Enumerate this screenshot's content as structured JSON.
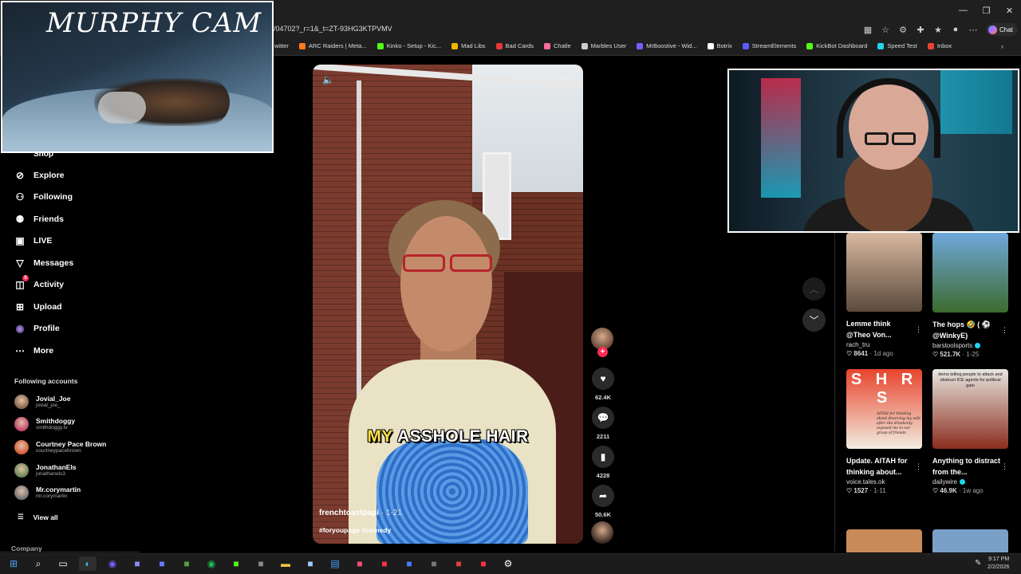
{
  "browser": {
    "url": "/04702?_r=1&_t=ZT-93HG3KTPVMV",
    "chat_label": "Chat",
    "window_controls": [
      "—",
      "❐",
      "✕"
    ],
    "bookmarks": [
      {
        "label": "witter",
        "color": "#1da1f2"
      },
      {
        "label": "ARC Raiders | Meta...",
        "color": "#ff7a1a"
      },
      {
        "label": "Kinko - Setup - Kic...",
        "color": "#53fc18"
      },
      {
        "label": "Mad Libs",
        "color": "#f5b400"
      },
      {
        "label": "Bad Cards",
        "color": "#e53935"
      },
      {
        "label": "Chatle",
        "color": "#ff6b9a"
      },
      {
        "label": "Marbles User",
        "color": "#cccccc"
      },
      {
        "label": "MrBoostive - Wid...",
        "color": "#7b5cff"
      },
      {
        "label": "Botrix",
        "color": "#ffffff"
      },
      {
        "label": "StreamElements",
        "color": "#5b5bff"
      },
      {
        "label": "KickBot Dashboard",
        "color": "#53fc18"
      },
      {
        "label": "Speed Test",
        "color": "#20d5ec"
      },
      {
        "label": "Inbox",
        "color": "#ea4335"
      }
    ]
  },
  "overlays": {
    "murphy_cam_title": "MURPHY CAM"
  },
  "sidebar": {
    "shop_label": "Shop",
    "items": [
      {
        "label": "Explore",
        "icon": "compass-icon"
      },
      {
        "label": "Following",
        "icon": "user-plus-icon"
      },
      {
        "label": "Friends",
        "icon": "friends-icon"
      },
      {
        "label": "LIVE",
        "icon": "live-icon"
      },
      {
        "label": "Messages",
        "icon": "messages-icon"
      },
      {
        "label": "Activity",
        "icon": "activity-icon",
        "badge": "5"
      },
      {
        "label": "Upload",
        "icon": "upload-icon"
      },
      {
        "label": "Profile",
        "icon": "profile-icon"
      },
      {
        "label": "More",
        "icon": "more-icon"
      }
    ],
    "following_header": "Following accounts",
    "accounts": [
      {
        "name": "Jovial_Joe",
        "handle": "jovial_joe_",
        "color": "#8a6a4e"
      },
      {
        "name": "Smithdoggy",
        "handle": "smithdoggy.tv",
        "color": "#c34a6d"
      },
      {
        "name": "Courtney Pace Brown",
        "handle": "courtneypacebrown",
        "color": "#d9603a"
      },
      {
        "name": "JonathanEls",
        "handle": "jonathanels3",
        "color": "#6e8a5a"
      },
      {
        "name": "Mr.corymartin",
        "handle": "mr.corymartin",
        "color": "#777777"
      }
    ],
    "view_all": "View all",
    "company": "Company"
  },
  "video": {
    "caption_highlight": "MY",
    "caption_rest": " ASSHOLE HAIR",
    "author": "frenchtoastpapi",
    "date": " · 1-21",
    "hashtags": "#foryoupage #comedy"
  },
  "actions": {
    "likes": "62.4K",
    "comments": "2211",
    "saves": "4228",
    "shares": "50.6K",
    "follow_plus": "+"
  },
  "recommended": [
    {
      "title": "Lemme think @Theo Von...",
      "author": "rach_tru",
      "verified": false,
      "likes": "8641",
      "ago": " · 1d ago",
      "thumb": [
        "#d8b8a0",
        "#5b4a3c"
      ]
    },
    {
      "title": "The hops 🤣 ( ⚽ @WinkyE)",
      "author": "barstoolsports",
      "verified": true,
      "likes": "521.7K",
      "ago": " · 1-25",
      "thumb": [
        "#6fa8dc",
        "#3d6b2e"
      ]
    },
    {
      "title": "Update. AITAH for thinking about...",
      "author": "voice.tales.ok",
      "verified": false,
      "likes": "1527",
      "ago": " · 1-11",
      "thumb": [
        "#e8442c",
        "#f2ede0"
      ]
    },
    {
      "title": "Anything to distract from the...",
      "author": "dailywire",
      "verified": true,
      "likes": "46.9K",
      "ago": " · 1w ago",
      "thumb": [
        "#e8e6e0",
        "#8a2d1e"
      ]
    }
  ],
  "rec_overlay_texts": {
    "aitah_banner": "S H R S",
    "aitah_note": "AITAH for thinking about divorcing my wife after she drunkenly exposed me to our group of friends",
    "dw_note": "dems telling people to attack and obstruct ICE agents for political gain"
  },
  "taskbar": {
    "time": "9:17 PM",
    "date": "2/2/2026",
    "icons": [
      {
        "name": "windows-start-icon",
        "color": "#4aa3ff"
      },
      {
        "name": "search-icon",
        "color": "#ffffff"
      },
      {
        "name": "task-view-icon",
        "color": "#ffffff"
      },
      {
        "name": "edge-icon",
        "color": "#33b8e8"
      },
      {
        "name": "chat-app-icon",
        "color": "#7a5cff"
      },
      {
        "name": "app-icon-1",
        "color": "#8a8aff"
      },
      {
        "name": "app-icon-2",
        "color": "#6a7aff"
      },
      {
        "name": "minecraft-icon",
        "color": "#5aa03c"
      },
      {
        "name": "spotify-icon",
        "color": "#1db954"
      },
      {
        "name": "app-icon-3",
        "color": "#53fc18"
      },
      {
        "name": "app-icon-4",
        "color": "#888888"
      },
      {
        "name": "file-explorer-icon",
        "color": "#f5c542"
      },
      {
        "name": "app-icon-5",
        "color": "#9ec8ff"
      },
      {
        "name": "notepad-icon",
        "color": "#4aa3ff"
      },
      {
        "name": "app-icon-6",
        "color": "#ff4a7a"
      },
      {
        "name": "app-icon-7",
        "color": "#ff3344"
      },
      {
        "name": "app-icon-8",
        "color": "#4a7aff"
      },
      {
        "name": "app-icon-9",
        "color": "#777777"
      },
      {
        "name": "app-icon-10",
        "color": "#e04040"
      },
      {
        "name": "app-icon-11",
        "color": "#ff3344"
      },
      {
        "name": "settings-icon",
        "color": "#ffffff"
      }
    ]
  }
}
